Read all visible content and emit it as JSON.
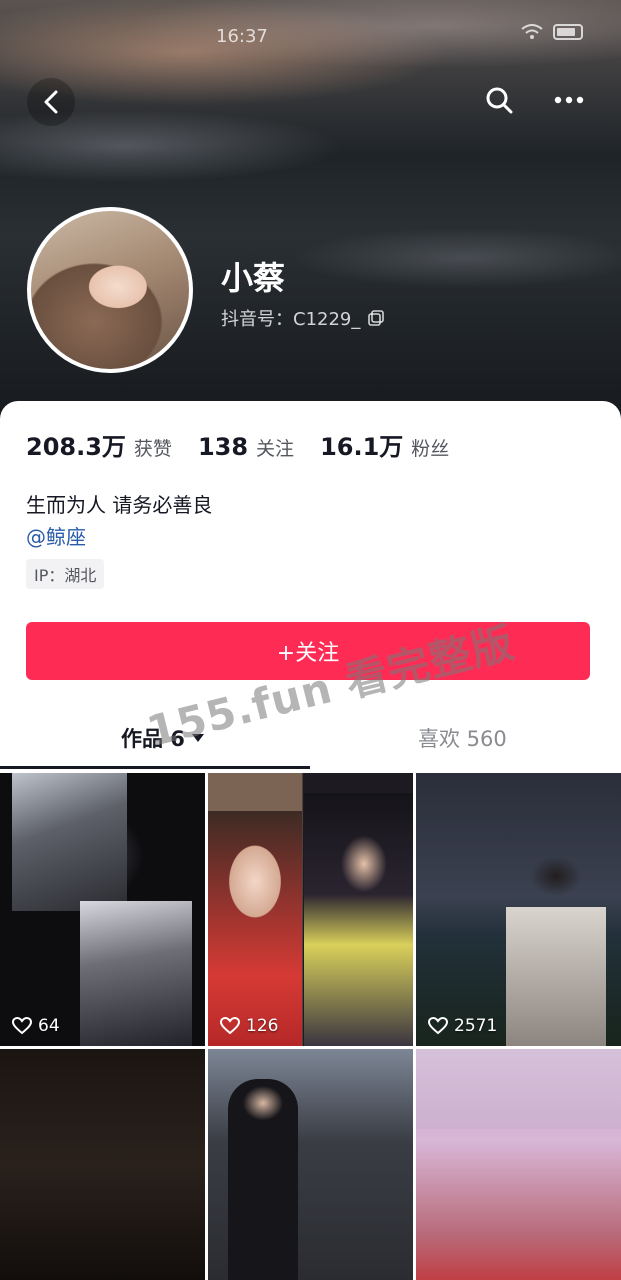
{
  "status_bar": {
    "time": "16:37"
  },
  "profile": {
    "name": "小蔡",
    "douyin_id": "抖音号：C1229_",
    "stats": [
      {
        "value": "208.3万",
        "label": "获赞"
      },
      {
        "value": "138",
        "label": "关注"
      },
      {
        "value": "16.1万",
        "label": "粉丝"
      }
    ],
    "bio": "生而为人 请务必善良",
    "mention": "@鲸座",
    "ip": "IP：湖北"
  },
  "follow_button": {
    "label": "+关注"
  },
  "tabs": [
    {
      "label": "作品 6",
      "active": true
    },
    {
      "label": "喜欢 560",
      "active": false
    }
  ],
  "videos": [
    {
      "likes": "64"
    },
    {
      "likes": "126"
    },
    {
      "likes": "2571"
    },
    {
      "likes": ""
    },
    {
      "likes": ""
    },
    {
      "likes": ""
    }
  ],
  "watermark": "155.fun 看完整版",
  "colors": {
    "accent": "#fe2c55",
    "mention": "#2a5caa",
    "text": "#161823"
  }
}
